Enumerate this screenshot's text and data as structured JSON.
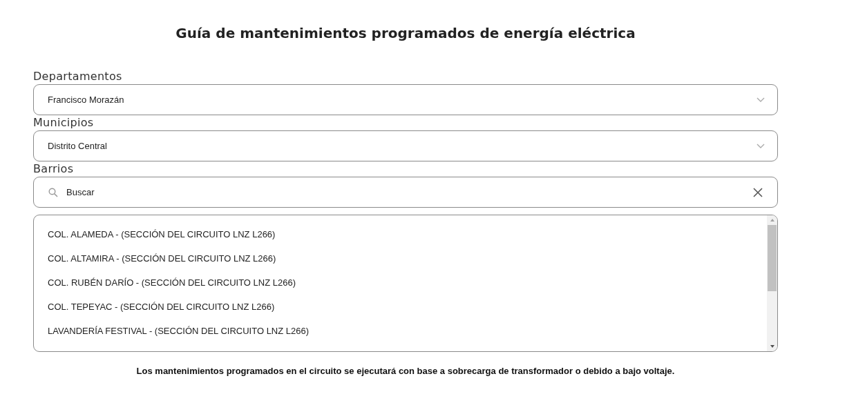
{
  "title": "Guía de mantenimientos programados de energía eléctrica",
  "departamentos": {
    "label": "Departamentos",
    "value": "Francisco Morazán"
  },
  "municipios": {
    "label": "Municipios",
    "value": "Distrito Central"
  },
  "barrios": {
    "label": "Barrios",
    "search": {
      "placeholder": "Buscar"
    },
    "items": [
      "COL. ALAMEDA - (SECCIÓN DEL CIRCUITO LNZ L266)",
      "COL. ALTAMIRA - (SECCIÓN DEL CIRCUITO LNZ L266)",
      "COL. RUBÉN DARÍO - (SECCIÓN DEL CIRCUITO LNZ L266)",
      "COL. TEPEYAC - (SECCIÓN DEL CIRCUITO LNZ L266)",
      "LAVANDERÍA FESTIVAL - (SECCIÓN DEL CIRCUITO LNZ L266)"
    ]
  },
  "note": "Los mantenimientos programados en el circuito se ejecutará con base a sobrecarga de transformador o debido a bajo voltaje."
}
